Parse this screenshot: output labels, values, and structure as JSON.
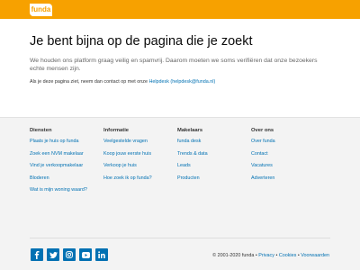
{
  "header": {
    "logo_text": "funda",
    "brand_color": "#f7a100"
  },
  "main": {
    "title": "Je bent bijna op de pagina die je zoekt",
    "intro": "We houden ons platform graag veilig en spamvrij. Daarom moeten we soms verifiëren dat onze bezoekers echte mensen zijn.",
    "contact_prefix": "Als je deze pagina ziet, neem dan contact op met onze ",
    "contact_link": "Helpdesk (helpdesk@funda.nl)"
  },
  "footer": {
    "columns": [
      {
        "title": "Diensten",
        "links": [
          "Plaats je huis op funda",
          "Zoek een NVM makelaar",
          "Vind je verkoopmakelaar",
          "Bloderen",
          "Wat is mijn woning waard?"
        ]
      },
      {
        "title": "Informatie",
        "links": [
          "Veelgestelde vragen",
          "Koop jouw eerste huis",
          "Verkoop je huis",
          "Hoe zoek ik op funda?"
        ]
      },
      {
        "title": "Makelaars",
        "links": [
          "funda desk",
          "Trends & data",
          "Leads",
          "Producten"
        ]
      },
      {
        "title": "Over ons",
        "links": [
          "Over funda",
          "Contact",
          "Vacatures",
          "Adverteren"
        ]
      }
    ],
    "social": [
      "facebook-icon",
      "twitter-icon",
      "instagram-icon",
      "youtube-icon",
      "linkedin-icon"
    ],
    "copyright": "© 2001-2020 funda",
    "legal_links": [
      "Privacy",
      "Cookies",
      "Voorwaarden"
    ],
    "separator": "•",
    "link_color": "#0071b3"
  }
}
